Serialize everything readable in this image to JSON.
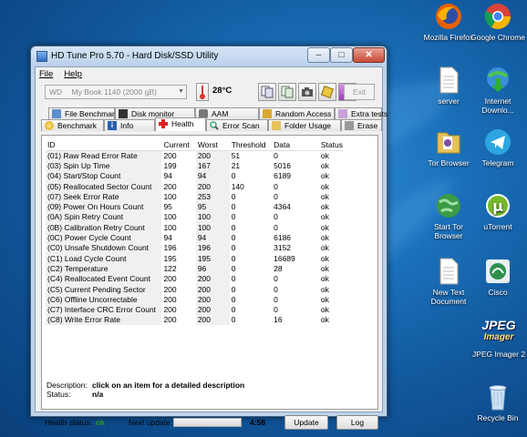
{
  "desktop": {
    "icons": [
      {
        "label": "Mozilla Firefox",
        "icon": "firefox-icon"
      },
      {
        "label": "Google Chrome",
        "icon": "chrome-icon"
      },
      {
        "label": "server",
        "icon": "document-icon"
      },
      {
        "label": "Internet Downlo...",
        "icon": "idm-icon"
      },
      {
        "label": "Tor Browser",
        "icon": "folder-icon"
      },
      {
        "label": "Telegram",
        "icon": "telegram-icon"
      },
      {
        "label": "Start Tor Browser",
        "icon": "globe-icon"
      },
      {
        "label": "uTorrent",
        "icon": "utorrent-icon"
      },
      {
        "label": "New Text Document",
        "icon": "document-icon"
      },
      {
        "label": "Cisco",
        "icon": "cisco-icon"
      },
      {
        "label": "JPEG Imager 2",
        "icon": "jpeg-imager-icon"
      },
      {
        "label": "Recycle Bin",
        "icon": "recycle-bin-icon"
      }
    ],
    "jpeg_logo_top": "JPEG",
    "jpeg_logo_bottom": "Imager"
  },
  "window": {
    "title": "HD Tune Pro 5.70 - Hard Disk/SSD Utility",
    "minimize": "–",
    "maximize": "□",
    "close": "✕"
  },
  "menu": {
    "file": "File",
    "help": "Help"
  },
  "toolbar": {
    "drive_prefix": "WD",
    "drive": "My Book 1140 (2000 gB)",
    "temperature": "28°C",
    "exit": "Exit"
  },
  "tabs": {
    "row1": [
      "File Benchmark",
      "Disk monitor",
      "AAM",
      "Random Access",
      "Extra tests"
    ],
    "row2": [
      "Benchmark",
      "Info",
      "Health",
      "Error Scan",
      "Folder Usage",
      "Erase"
    ],
    "active": "Health"
  },
  "table": {
    "headers": [
      "ID",
      "Current",
      "Worst",
      "Threshold",
      "Data",
      "Status"
    ],
    "rows": [
      [
        "(01) Raw Read Error Rate",
        "200",
        "200",
        "51",
        "0",
        "ok"
      ],
      [
        "(03) Spin Up Time",
        "199",
        "167",
        "21",
        "5016",
        "ok"
      ],
      [
        "(04) Start/Stop Count",
        "94",
        "94",
        "0",
        "6189",
        "ok"
      ],
      [
        "(05) Reallocated Sector Count",
        "200",
        "200",
        "140",
        "0",
        "ok"
      ],
      [
        "(07) Seek Error Rate",
        "100",
        "253",
        "0",
        "0",
        "ok"
      ],
      [
        "(09) Power On Hours Count",
        "95",
        "95",
        "0",
        "4364",
        "ok"
      ],
      [
        "(0A) Spin Retry Count",
        "100",
        "100",
        "0",
        "0",
        "ok"
      ],
      [
        "(0B) Calibration Retry Count",
        "100",
        "100",
        "0",
        "0",
        "ok"
      ],
      [
        "(0C) Power Cycle Count",
        "94",
        "94",
        "0",
        "6186",
        "ok"
      ],
      [
        "(C0) Unsafe Shutdown Count",
        "196",
        "196",
        "0",
        "3152",
        "ok"
      ],
      [
        "(C1) Load Cycle Count",
        "195",
        "195",
        "0",
        "16689",
        "ok"
      ],
      [
        "(C2) Temperature",
        "122",
        "96",
        "0",
        "28",
        "ok"
      ],
      [
        "(C4) Reallocated Event Count",
        "200",
        "200",
        "0",
        "0",
        "ok"
      ],
      [
        "(C5) Current Pending Sector",
        "200",
        "200",
        "0",
        "0",
        "ok"
      ],
      [
        "(C6) Offline Uncorrectable",
        "200",
        "200",
        "0",
        "0",
        "ok"
      ],
      [
        "(C7) Interface CRC Error Count",
        "200",
        "200",
        "0",
        "0",
        "ok"
      ],
      [
        "(C8) Write Error Rate",
        "200",
        "200",
        "0",
        "16",
        "ok"
      ]
    ]
  },
  "details": {
    "description_label": "Description:",
    "description_value": "click on an item for a detailed description",
    "status_label": "Status:",
    "status_value": "n/a"
  },
  "footer": {
    "health_label": "Health status:",
    "health_value": "ok",
    "next_update_label": "Next update:",
    "countdown": "4:58",
    "update": "Update",
    "log": "Log"
  },
  "colors": {
    "ok": "#2c9a22",
    "desktop": "#1a6fb9"
  }
}
